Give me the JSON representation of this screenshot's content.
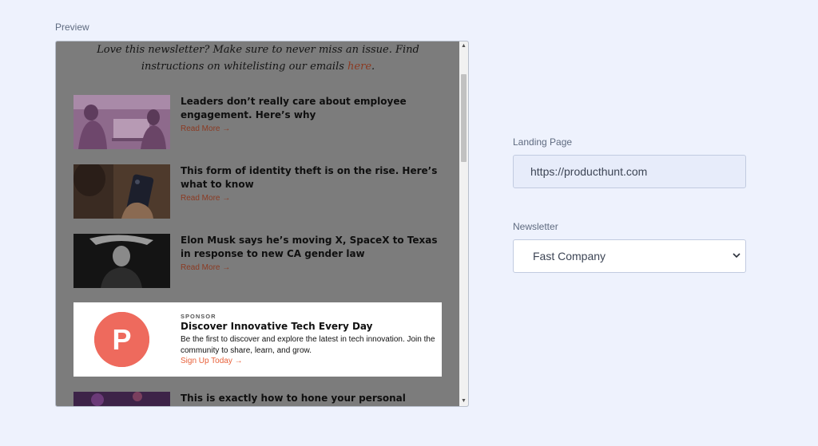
{
  "preview": {
    "label": "Preview",
    "intro_text": "Love this newsletter? Make sure to never miss an issue. Find instructions on whitelisting our emails ",
    "intro_link": "here",
    "intro_end": ".",
    "articles": [
      {
        "title": "Leaders don’t really care about employee engagement. Here’s why",
        "cta": "Read More →",
        "image": "women-at-laptop-photo"
      },
      {
        "title": "This form of identity theft is on the rise. Here’s what to know",
        "cta": "Read More →",
        "image": "hand-holding-phone-photo"
      },
      {
        "title": "Elon Musk says he’s moving X, SpaceX to Texas in response to new CA gender law",
        "cta": "Read More →",
        "image": "elon-musk-photo"
      },
      {
        "title": "This is exactly how to hone your personal",
        "cta": "",
        "image": "abstract-purple-photo"
      }
    ],
    "sponsor": {
      "tag": "SPONSOR",
      "logo_letter": "P",
      "title": "Discover Innovative Tech Every Day",
      "body": "Be the first to discover and explore the latest in tech innovation. Join the community to share, learn, and grow.",
      "cta": "Sign Up Today →",
      "logo_color": "#ee6a5d"
    }
  },
  "form": {
    "landing_page": {
      "label": "Landing Page",
      "value": "https://producthunt.com"
    },
    "newsletter": {
      "label": "Newsletter",
      "selected": "Fast Company"
    }
  },
  "colors": {
    "page_background": "#eef2fd",
    "overlay": "#7c7c7c",
    "link": "#8b3a22",
    "sponsor_cta": "#e8613a"
  }
}
